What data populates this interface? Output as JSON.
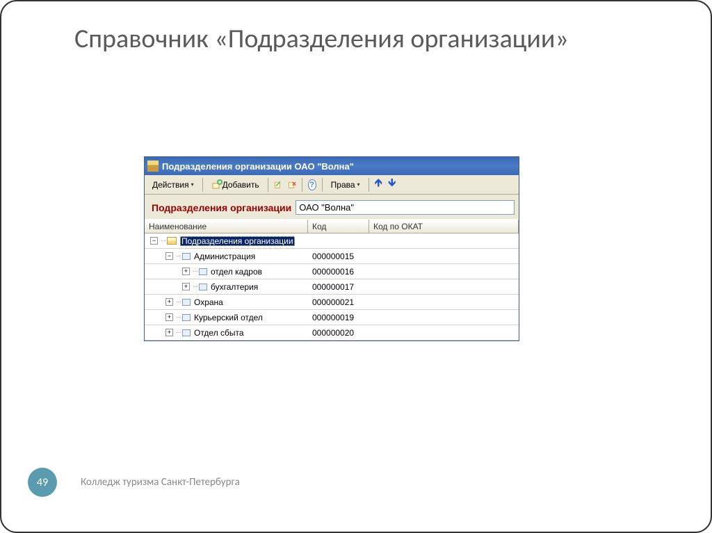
{
  "slide": {
    "title": "Справочник «Подразделения организации»"
  },
  "window": {
    "title": "Подразделения организации ОАО \"Волна\""
  },
  "toolbar": {
    "actions_label": "Действия",
    "add_label": "Добавить",
    "rights_label": "Права"
  },
  "header": {
    "label": "Подразделения организации",
    "org_value": "ОАО \"Волна\""
  },
  "columns": {
    "name": "Наименование",
    "code": "Код",
    "okat": "Код по ОКАТ"
  },
  "tree": [
    {
      "level": 0,
      "expander": "−",
      "icon": "folder",
      "label": "Подразделения организации",
      "code": "",
      "selected": true
    },
    {
      "level": 1,
      "expander": "−",
      "icon": "item",
      "label": "Администрация",
      "code": "000000015",
      "selected": false
    },
    {
      "level": 2,
      "expander": "+",
      "icon": "item",
      "label": "отдел кадров",
      "code": "000000016",
      "selected": false
    },
    {
      "level": 2,
      "expander": "+",
      "icon": "item",
      "label": "бухгалтерия",
      "code": "000000017",
      "selected": false
    },
    {
      "level": 1,
      "expander": "+",
      "icon": "item",
      "label": "Охрана",
      "code": "000000021",
      "selected": false
    },
    {
      "level": 1,
      "expander": "+",
      "icon": "item",
      "label": "Курьерский отдел",
      "code": "000000019",
      "selected": false
    },
    {
      "level": 1,
      "expander": "+",
      "icon": "item",
      "label": "Отдел сбыта",
      "code": "000000020",
      "selected": false
    }
  ],
  "footer": {
    "page": "49",
    "text": "Колледж туризма Санкт-Петербурга"
  }
}
